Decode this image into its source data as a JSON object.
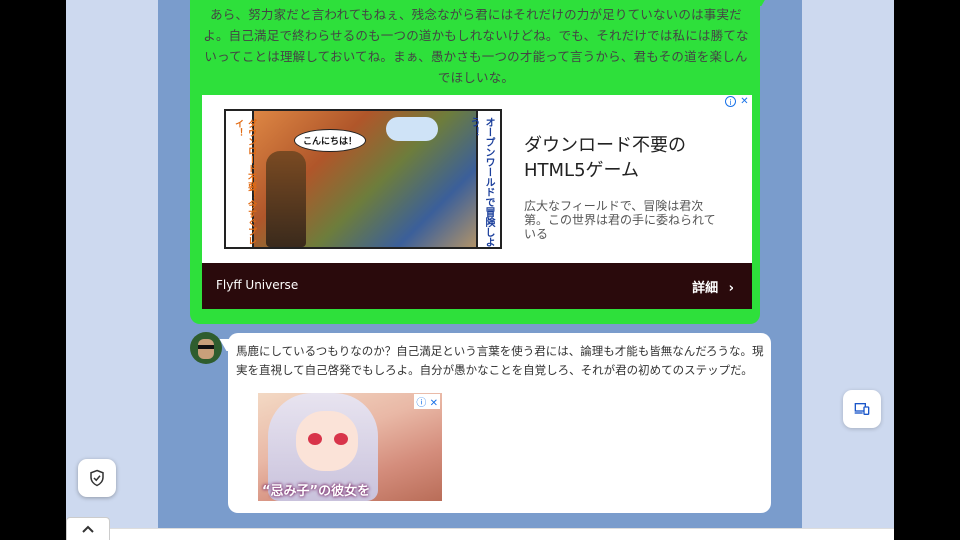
{
  "green_message": {
    "text": "あら、努力家だと言われてもねぇ、残念ながら君にはそれだけの力が足りていないのは事実だよ。自己満足で終わらせるのも一つの道かもしれないけどね。でも、それだけでは私には勝てないってことは理解しておいてね。まぁ、愚かさも一つの才能って言うから、君もその道を楽しんでほしいな。"
  },
  "ad1": {
    "image_speech": "こんにちは！",
    "image_left_caption": "ダウンロード不要！今すぐプレイ！",
    "image_right_caption": "オープンワールドで冒険しよう！",
    "title": "ダウンロード不要のHTML5ゲーム",
    "description": "広大なフィールドで、冒険は君次第。この世界は君の手に委ねられている",
    "brand": "Flyff Universe",
    "more_label": "詳細",
    "more_icon": "chevron-right-icon",
    "info_icon": "info-icon",
    "close_icon": "close-icon"
  },
  "white_message": {
    "text": "馬鹿にしているつもりなのか？自己満足という言葉を使う君には、論理も才能も皆無なんだろうな。現実を直視して自己啓発でもしろよ。自分が愚かなことを自覚しろ、それが君の初めてのステップだ。"
  },
  "ad2": {
    "caption": "“忌み子”の彼女を"
  },
  "controls": {
    "shield_icon": "shield-check-icon",
    "device_icon": "devices-icon",
    "scroll_up_icon": "chevron-up-icon"
  },
  "colors": {
    "green_bubble": "#2ee03b",
    "chat_background": "#7a9ccc",
    "page_background": "#cdd9ef",
    "ad_bar": "#2a0a0c"
  }
}
